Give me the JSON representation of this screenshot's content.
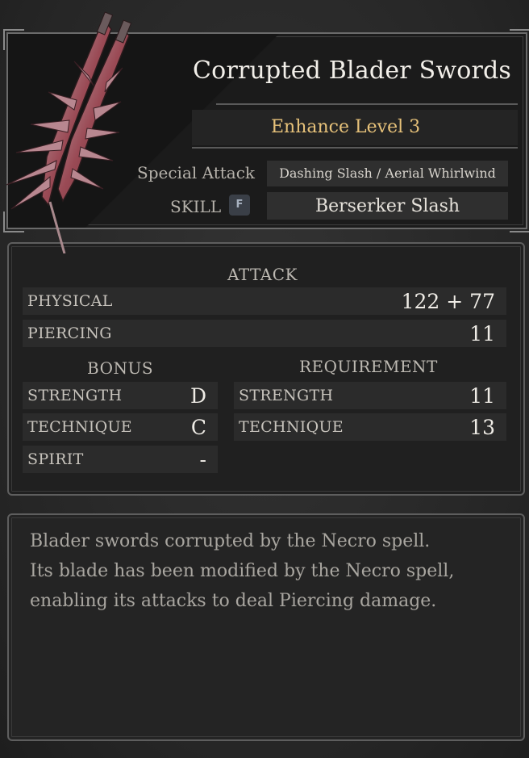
{
  "item": {
    "name": "Corrupted Blader Swords",
    "enhance": "Enhance Level 3",
    "special_attack_label": "Special Attack",
    "special_attack_value": "Dashing Slash / Aerial Whirlwind",
    "skill_label": "SKILL",
    "skill_key": "F",
    "skill_value": "Berserker Slash"
  },
  "attack": {
    "heading": "ATTACK",
    "rows": [
      {
        "label": "PHYSICAL",
        "value": "122 + 77"
      },
      {
        "label": "PIERCING",
        "value": "11"
      }
    ]
  },
  "bonus": {
    "heading": "BONUS",
    "rows": [
      {
        "label": "STRENGTH",
        "value": "D"
      },
      {
        "label": "TECHNIQUE",
        "value": "C"
      },
      {
        "label": "SPIRIT",
        "value": "-"
      }
    ]
  },
  "requirement": {
    "heading": "REQUIREMENT",
    "rows": [
      {
        "label": "STRENGTH",
        "value": "11"
      },
      {
        "label": "TECHNIQUE",
        "value": "13"
      }
    ]
  },
  "description": {
    "lines": [
      "Blader swords corrupted by the Necro spell.",
      "Its blade has been modified by the Necro spell,",
      "enabling its attacks to deal Piercing damage."
    ]
  },
  "colors": {
    "enhance_gold": "#e7c27a",
    "weapon_red": "#9a4a55"
  },
  "icons": [
    "corrupted-blader-swords-icon",
    "f-key-icon"
  ]
}
